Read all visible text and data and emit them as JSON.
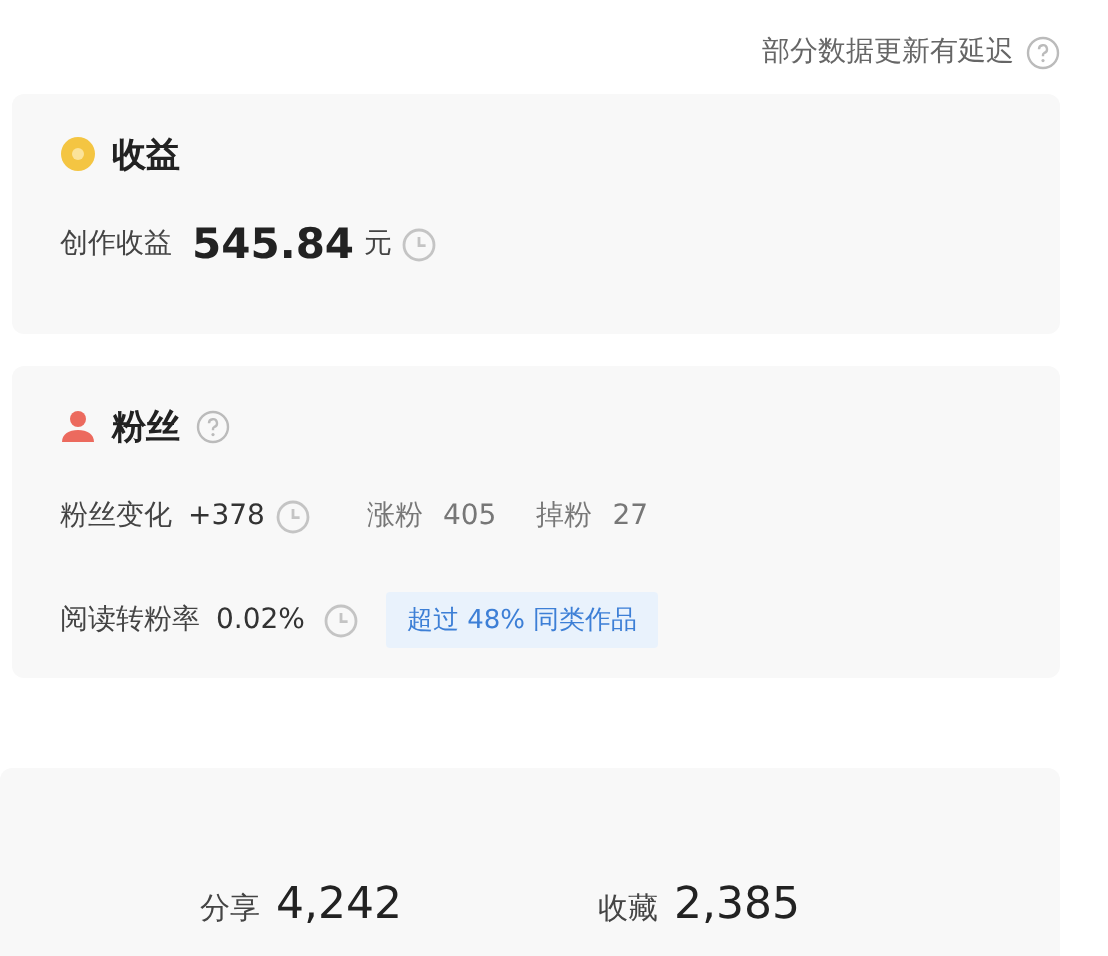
{
  "notice": {
    "text": "部分数据更新有延迟"
  },
  "income": {
    "title": "收益",
    "label": "创作收益",
    "value": "545.84",
    "unit": "元"
  },
  "fans": {
    "title": "粉丝",
    "change_label": "粉丝变化",
    "change_value": "+378",
    "stats": [
      {
        "label": "涨粉",
        "value": "405"
      },
      {
        "label": "掉粉",
        "value": "27"
      }
    ],
    "rate_label": "阅读转粉率",
    "rate_value": "0.02%",
    "rate_badge": "超过 48% 同类作品"
  },
  "engagement": [
    {
      "label": "分享",
      "value": "4,242"
    },
    {
      "label": "收藏",
      "value": "2,385"
    }
  ]
}
